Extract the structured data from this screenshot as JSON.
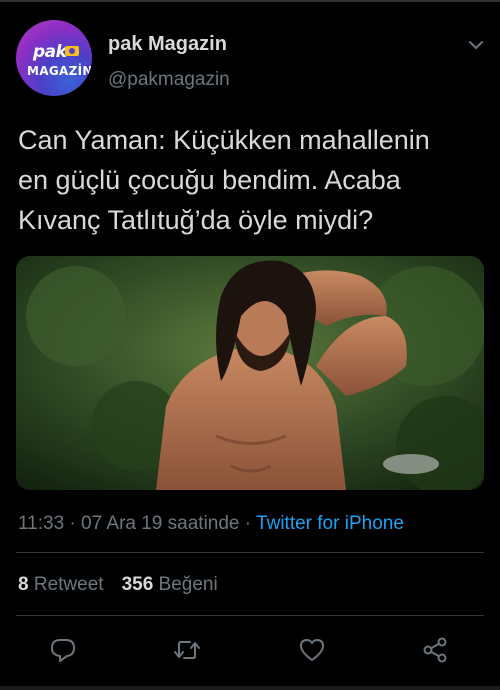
{
  "author": {
    "display_name": "pak Magazin",
    "handle": "@pakmagazin",
    "avatar_logo_top": "pak",
    "avatar_logo_bottom": "MAGAZİN"
  },
  "tweet": {
    "text": "Can Yaman: Küçükken mahallenin\nen güçlü çocuğu bendim. Acaba\nKıvanç Tatlıtuğ’da öyle miydi?",
    "time": "11:33",
    "date": "07 Ara 19 saatinde",
    "source": "Twitter for iPhone"
  },
  "stats": {
    "retweet_count": "8",
    "retweet_label": "Retweet",
    "like_count": "356",
    "like_label": "Beğeni"
  },
  "actions": [
    "reply-icon",
    "retweet-icon",
    "like-icon",
    "share-icon"
  ],
  "colors": {
    "background": "#000000",
    "text": "#d9d9d9",
    "muted": "#6e767d",
    "link": "#1da1f2",
    "divider": "#2f3336"
  }
}
